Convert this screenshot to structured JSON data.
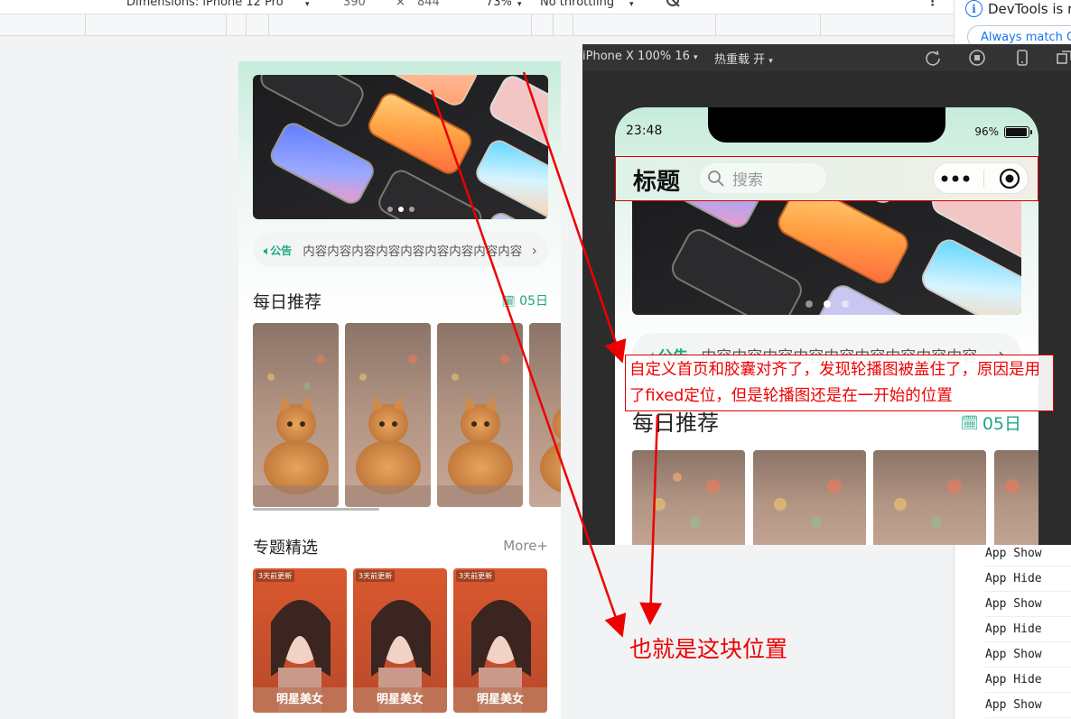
{
  "devtools": {
    "dimensions_label": "Dimensions: iPhone 12 Pro",
    "width_value": "390",
    "times": "×",
    "height_value": "844",
    "zoom": "73%",
    "throttle": "No throttling",
    "more": "⋮",
    "info_text": "DevTools is n",
    "always_match": "Always match C",
    "console_logs": [
      "App Show",
      "App Hide",
      "App Show",
      "App Hide",
      "App Show",
      "App Hide",
      "App Show"
    ]
  },
  "browser_page": {
    "notice_tag": "公告",
    "notice_text": "内容内容内容内容内容内容内容内容内容",
    "daily_title": "每日推荐",
    "daily_date": "05日",
    "topic_title": "专题精选",
    "topic_more": "More+",
    "topic_badge": "3天前更新",
    "topic_caption": "明星美女"
  },
  "simulator": {
    "device": "iPhone X 100% 16",
    "hot_reload": "热重载 开",
    "time": "23:48",
    "battery": "96%",
    "nav_title": "标题",
    "search_placeholder": "搜索",
    "notice_tag": "公告",
    "notice_text": "内容内容内容内容内容内容内容内容内容",
    "daily_title": "每日推荐",
    "daily_date": "05日"
  },
  "annotations": {
    "box_text": "自定义首页和胶囊对齐了，发现轮播图被盖住了，原因是用了fixed定位，但是轮播图还是在一开始的位置",
    "label_text": "也就是这块位置",
    "color": "#e00000"
  }
}
